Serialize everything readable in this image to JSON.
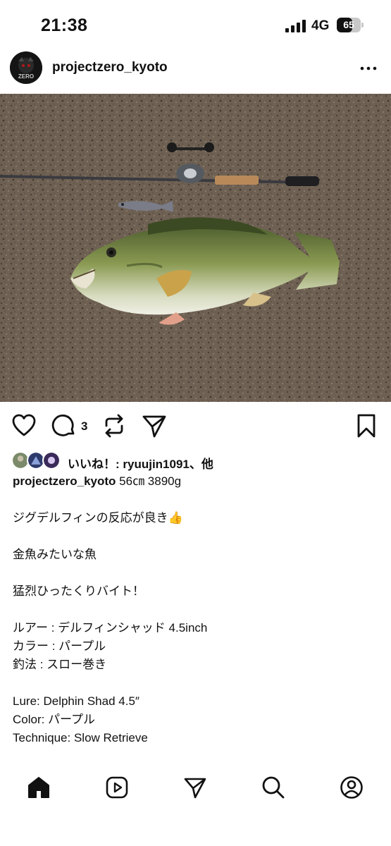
{
  "status_bar": {
    "time": "21:38",
    "network": "4G",
    "battery_level": "65",
    "battery_fraction": 0.65
  },
  "post": {
    "username": "projectzero_kyoto",
    "avatar_text": "ZERO",
    "comment_count": "3",
    "likes_text": "いいね！: ryuujin1091、他",
    "caption_user": "projectzero_kyoto",
    "caption_first_line": " 56㎝ 3890g",
    "caption_lines": [
      "",
      "ジグデルフィンの反応が良き👍",
      "",
      "金魚みたいな魚",
      "",
      "猛烈ひったくりバイト！",
      "",
      "ルアー : デルフィンシャッド 4.5inch",
      "カラー : パープル",
      "釣法 : スロー巻き",
      "",
      "Lure: Delphin Shad 4.5″",
      "Color: パープル",
      "Technique: Slow Retrieve"
    ]
  },
  "icons": {
    "more": "more-options-icon",
    "like": "heart-icon",
    "comment": "comment-icon",
    "repost": "repost-icon",
    "share": "send-icon",
    "save": "bookmark-icon",
    "nav": [
      "home-icon",
      "reels-icon",
      "send-icon",
      "search-icon",
      "profile-icon"
    ]
  }
}
